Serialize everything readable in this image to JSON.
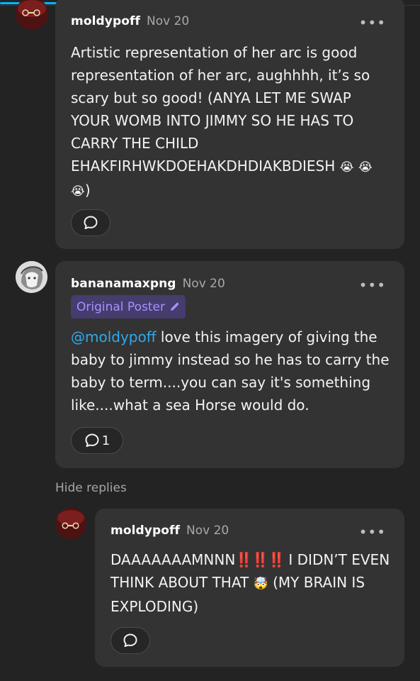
{
  "comments": [
    {
      "username": "moldypoff",
      "date": "Nov 20",
      "text": "Artistic representation of her arc is good representation of her arc, aughhhh, it’s so scary but so good! (ANYA LET ME SWAP YOUR WOMB INTO JIMMY SO HE HAS TO CARRY THE CHILD EHAKFIRHWKDOEHAKDHDIAKBDIESH",
      "emoji_1": "😭",
      "emoji_2": "😭😭",
      "text_end": ")"
    },
    {
      "username": "bananamaxpng",
      "date": "Nov 20",
      "badge": "Original Poster",
      "mention": "@moldypoff",
      "text": " love this imagery of giving the baby to jimmy instead so he has to carry the baby to term....you can say it's something like....what a sea Horse would do.",
      "reply_count": "1"
    },
    {
      "username": "moldypoff",
      "date": "Nov 20",
      "text_start": "DAAAAAAAMNNN",
      "exclaims": "‼️‼️‼️",
      "text_mid": " I DIDN’T EVEN THINK ABOUT THAT ",
      "emoji": "🤯",
      "text_end": " (MY BRAIN IS EXPLODING)"
    }
  ],
  "hide_replies_label": "Hide replies",
  "more_label": "•••",
  "icons": {
    "reply": "speech-bubble-icon",
    "edit": "pencil-icon"
  },
  "colors": {
    "accent_progress": "#00b8ff",
    "mention": "#2fa9ec",
    "badge_text": "#a892ff",
    "card_bg": "#333333",
    "page_bg": "#232323"
  }
}
